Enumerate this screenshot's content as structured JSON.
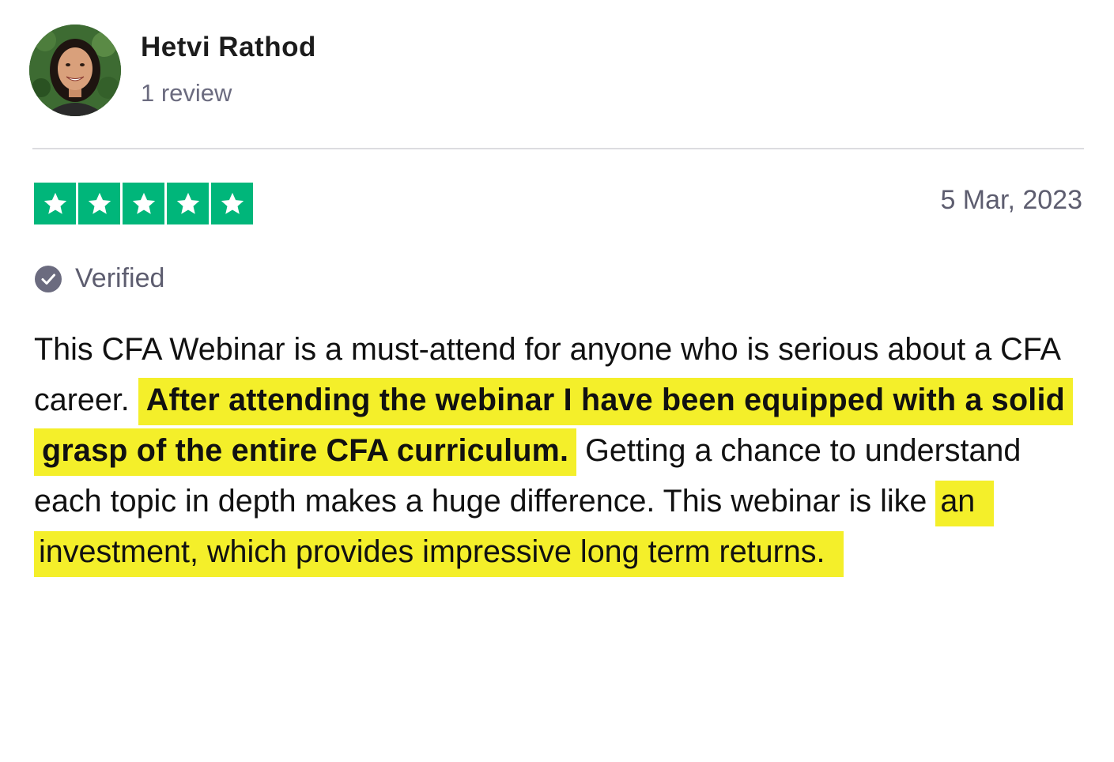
{
  "reviewer": {
    "name": "Hetvi Rathod",
    "review_count": "1 review",
    "avatar_icon": "reviewer-photo"
  },
  "rating": {
    "stars": 5,
    "max_stars": 5,
    "color": "#00b67a",
    "star_icon": "star-icon"
  },
  "date": "5 Mar, 2023",
  "verified": {
    "label": "Verified",
    "icon": "check-circle-icon",
    "color": "#6b6b7f"
  },
  "review": {
    "part1": "This CFA Webinar is a must-attend for anyone who is serious about a CFA career. ",
    "highlight1": "After attending the webinar I have been equipped with a solid grasp of the entire CFA curriculum.",
    "part2": " Getting a chance to understand each topic in depth makes a huge difference. This webinar is like ",
    "highlight2": "an investment, which provides impressive long term returns.",
    "highlight_color": "#f4ef2a"
  }
}
